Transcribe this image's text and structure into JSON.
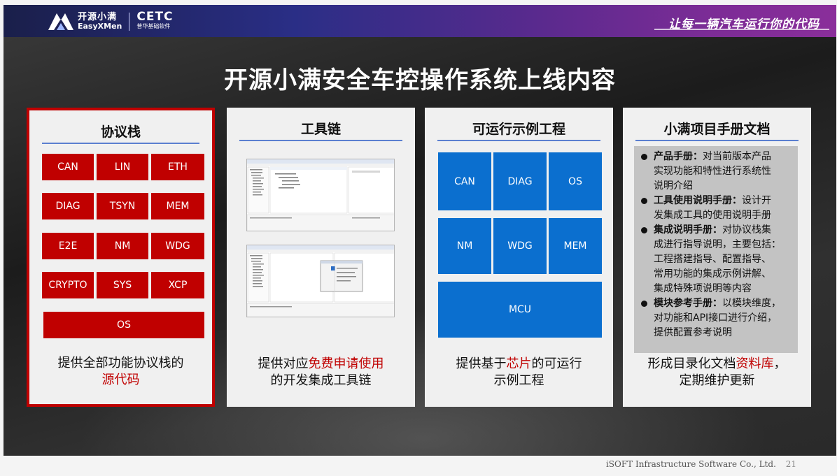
{
  "header": {
    "logo_cn": "开源小满",
    "logo_en": "EasyXMen",
    "partner_name": "CETC",
    "partner_sub": "普华基础软件",
    "slogan": "让每一辆汽车运行你的代码"
  },
  "title": "开源小满安全车控操作系统上线内容",
  "cards": {
    "protocol": {
      "title": "协议栈",
      "modules": [
        "CAN",
        "LIN",
        "ETH",
        "DIAG",
        "TSYN",
        "MEM",
        "E2E",
        "NM",
        "WDG",
        "CRYPTO",
        "SYS",
        "XCP",
        "OS"
      ],
      "desc_line1": "提供全部功能协议栈的",
      "desc_line2_hl": "源代码"
    },
    "toolchain": {
      "title": "工具链",
      "desc_pre": "提供对应",
      "desc_hl": "免费申请使用",
      "desc_line2": "的开发集成工具链"
    },
    "examples": {
      "title": "可运行示例工程",
      "modules": [
        "CAN",
        "DIAG",
        "OS",
        "NM",
        "WDG",
        "MEM",
        "MCU"
      ],
      "desc_pre": "提供基于",
      "desc_hl": "芯片",
      "desc_post": "的可运行",
      "desc_line2": "示例工程"
    },
    "docs": {
      "title": "小满项目手册文档",
      "items": [
        {
          "head": "产品手册：",
          "lines": [
            "对当前版本产品",
            "实现功能和特性进行系统性",
            "说明介绍"
          ]
        },
        {
          "head": "工具使用说明手册：",
          "lines": [
            "设计开",
            "发集成工具的使用说明手册"
          ]
        },
        {
          "head": "集成说明手册：",
          "lines": [
            "对协议栈集",
            "成进行指导说明，主要包括：",
            "工程搭建指导、配置指导、",
            "常用功能的集成示例讲解、",
            "集成特殊项说明等内容"
          ]
        },
        {
          "head": "模块参考手册：",
          "lines": [
            "以模块维度，",
            "对功能和API接口进行介绍，",
            "提供配置参考说明"
          ]
        }
      ],
      "desc_pre": "形成目录化文档",
      "desc_hl": "资料库",
      "desc_post": "，",
      "desc_line2": "定期维护更新"
    }
  },
  "footer": {
    "company": "iSOFT Infrastructure Software Co., Ltd.",
    "page": "21"
  },
  "colors": {
    "accent_red": "#c00000",
    "accent_blue": "#0b6fcf",
    "header_purple": "#7c2c96"
  }
}
